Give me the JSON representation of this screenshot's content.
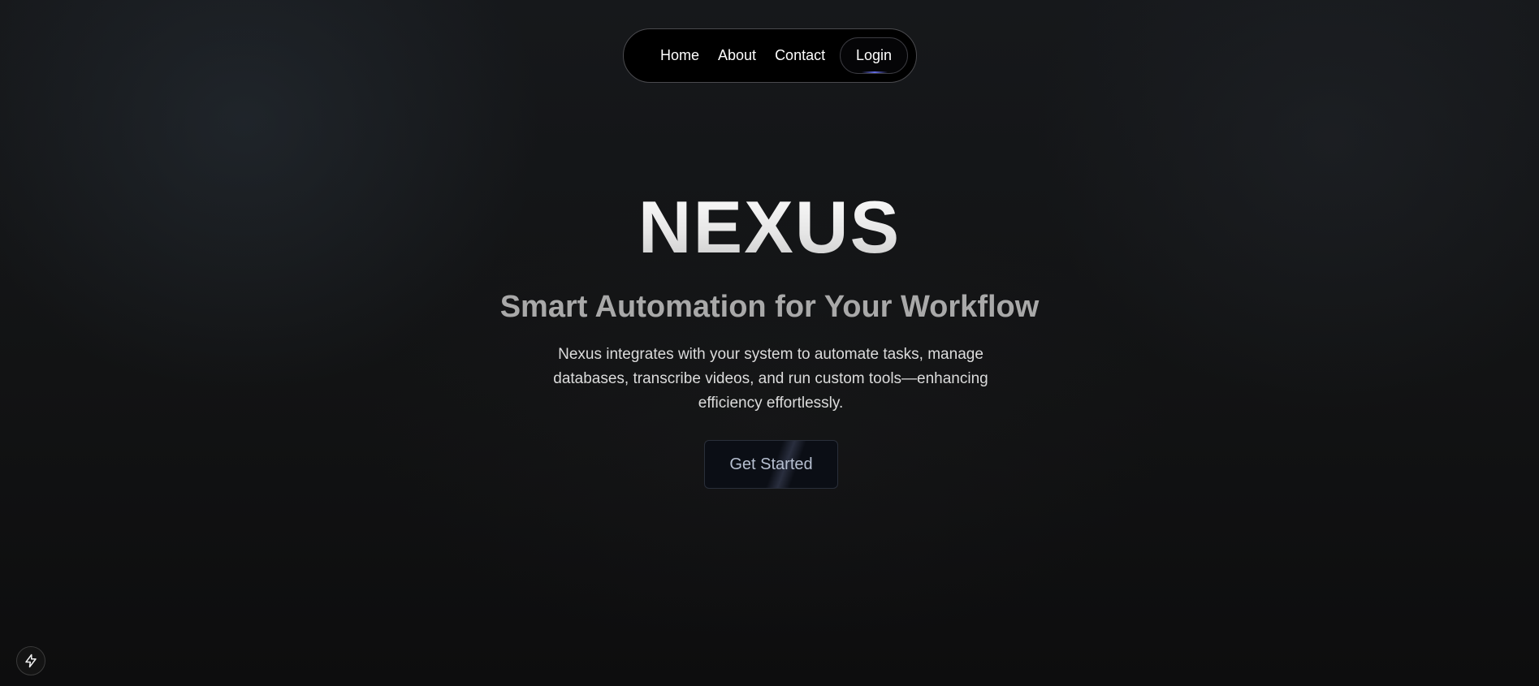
{
  "nav": {
    "links": [
      {
        "label": "Home"
      },
      {
        "label": "About"
      },
      {
        "label": "Contact"
      }
    ],
    "login_label": "Login"
  },
  "hero": {
    "title": "NEXUS",
    "subtitle": "Smart Automation for Your Workflow",
    "description": "Nexus integrates with your system to automate tasks, manage databases, transcribe videos, and run custom tools—enhancing efficiency effortlessly.",
    "cta_label": "Get Started"
  },
  "badge": {
    "icon": "lightning-bolt-icon"
  },
  "colors": {
    "background": "#121314",
    "nav_background": "#000000",
    "nav_border": "#4a4a4e",
    "title": "#e9e9e9",
    "subtitle": "#a9a9a9",
    "description": "#dcdcdc",
    "cta_text": "#b6bfd0",
    "cta_background": "#0b0e15",
    "login_glow": "#6e78ff"
  }
}
